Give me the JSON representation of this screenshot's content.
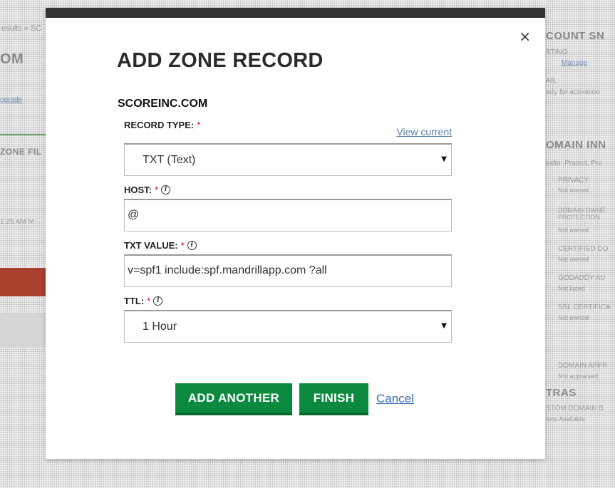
{
  "modal": {
    "title": "ADD ZONE RECORD",
    "domain": "SCOREINC.COM",
    "close_symbol": "×",
    "view_current_link": "View current",
    "fields": {
      "record_type": {
        "label": "RECORD TYPE:",
        "required_mark": "*",
        "value": "TXT (Text)"
      },
      "host": {
        "label": "HOST:",
        "required_mark": "*",
        "value": "@"
      },
      "txt_value": {
        "label": "TXT VALUE:",
        "required_mark": "*",
        "value": "v=spf1 include:spf.mandrillapp.com ?all"
      },
      "ttl": {
        "label": "TTL:",
        "required_mark": "*",
        "value": "1 Hour"
      }
    },
    "info_symbol": "i",
    "caret_symbol": "▼",
    "buttons": {
      "add_another": "ADD ANOTHER",
      "finish": "FINISH",
      "cancel": "Cancel"
    }
  },
  "background": {
    "breadcrumb": "esults » SC",
    "domain_fragment": "OM",
    "left_link": "pgrade",
    "zone_heading": "ZONE FIL",
    "timestamp": "1:25 AM M",
    "right_heading_1": "COUNT SN",
    "hosting": "STING",
    "manage_link": "Manage",
    "email": "AIL",
    "ready": "ady for activation",
    "right_heading_2": "OMAIN INN",
    "protect": "ssfin, Protect, Pro",
    "items": [
      "PRIVACY",
      "DOMAIN OWNE PROTECTION",
      "CERTIFIED DO",
      "GODADDY AU",
      "SSL CERTIFICA",
      "DOMAIN APPR"
    ],
    "item_status": [
      "Not owned",
      "Not owned",
      "Not owned",
      "Not listed",
      "Not owned",
      "Not owned",
      "Not appraised"
    ],
    "extras": "TRAS",
    "custom": "STOM DOMAIN B",
    "options": "ions Available"
  },
  "colors": {
    "primary_button": "#0b8a3f",
    "link": "#5b7fb0",
    "required": "#d0021b",
    "modal_bar": "#333333"
  }
}
